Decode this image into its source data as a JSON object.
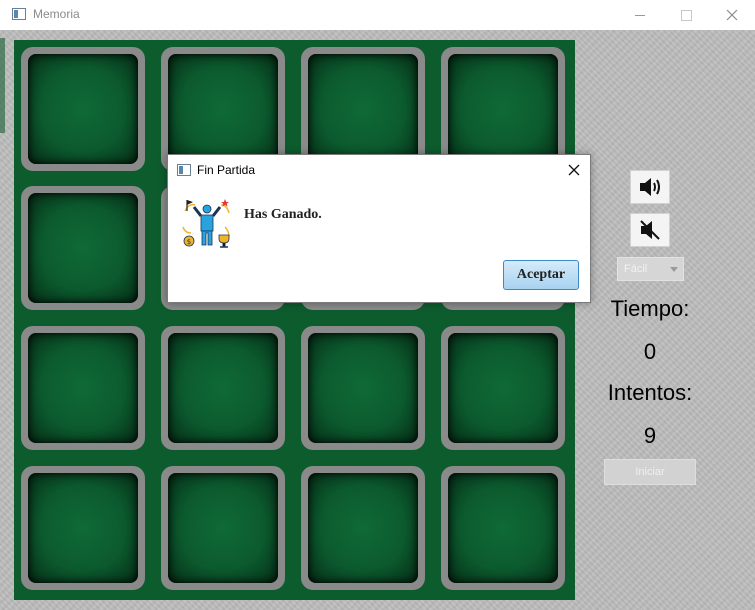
{
  "window": {
    "title": "Memoria",
    "icon": "window-app-icon",
    "controls": [
      "minimize-icon",
      "maximize-icon",
      "close-icon"
    ]
  },
  "board": {
    "rows": 4,
    "cols": 4,
    "card_state": "face-down",
    "colors": {
      "board": "#0d5c2e",
      "card_border": "#8a8a8a"
    }
  },
  "controls": {
    "sound_on_icon": "speaker-on-icon",
    "sound_off_icon": "speaker-muted-icon",
    "difficulty": {
      "selected": "Fácil"
    },
    "tiempo_label": "Tiempo:",
    "tiempo_value": "0",
    "intentos_label": "Intentos:",
    "intentos_value": "9",
    "start_label": "Iniciar"
  },
  "dialog": {
    "title": "Fin Partida",
    "message": "Has Ganado.",
    "ok_label": "Aceptar",
    "image": "winner-trophy-icon",
    "colors": {
      "button": "#a8d2f0",
      "button_border": "#3c8ac7"
    }
  }
}
